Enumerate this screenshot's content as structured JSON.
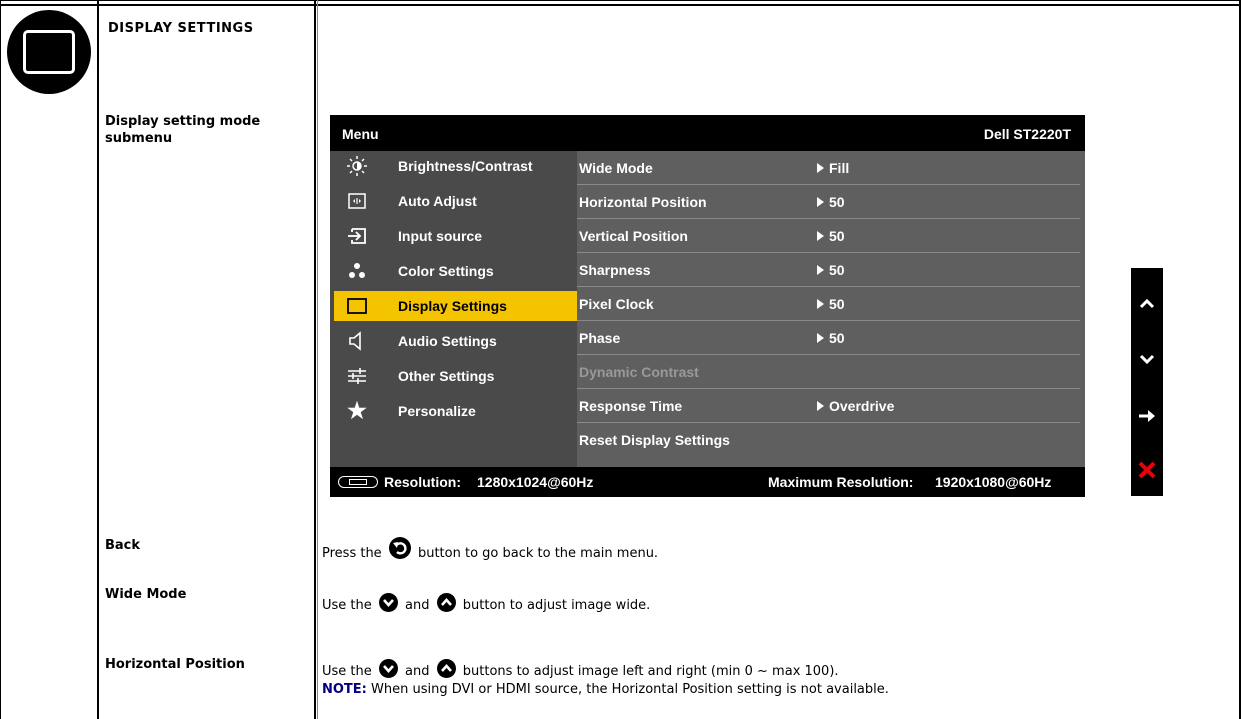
{
  "section": {
    "heading": "DISPLAY SETTINGS",
    "icon": "display-settings-icon"
  },
  "rows": {
    "submenu_label": "Display setting mode submenu",
    "back_label": "Back",
    "wide_mode_label": "Wide Mode",
    "horizontal_position_label": "Horizontal Position"
  },
  "osd": {
    "menu_title": "Menu",
    "model": "Dell ST2220T",
    "nav": [
      {
        "label": "Brightness/Contrast",
        "icon": "brightness-icon"
      },
      {
        "label": "Auto Adjust",
        "icon": "auto-adjust-icon"
      },
      {
        "label": "Input source",
        "icon": "input-source-icon"
      },
      {
        "label": "Color Settings",
        "icon": "color-settings-icon"
      },
      {
        "label": "Display Settings",
        "icon": "display-icon",
        "active": true
      },
      {
        "label": "Audio Settings",
        "icon": "speaker-icon"
      },
      {
        "label": "Other Settings",
        "icon": "sliders-icon"
      },
      {
        "label": "Personalize",
        "icon": "star-icon"
      }
    ],
    "options": [
      {
        "name": "Wide Mode",
        "value": "Fill"
      },
      {
        "name": "Horizontal Position",
        "value": "50"
      },
      {
        "name": "Vertical Position",
        "value": "50"
      },
      {
        "name": "Sharpness",
        "value": "50"
      },
      {
        "name": "Pixel Clock",
        "value": "50"
      },
      {
        "name": "Phase",
        "value": "50"
      },
      {
        "name": "Dynamic Contrast",
        "value": "",
        "disabled": true
      },
      {
        "name": "Response Time",
        "value": "Overdrive"
      },
      {
        "name": "Reset Display Settings",
        "value": ""
      }
    ],
    "status": {
      "resolution_label": "Resolution:",
      "resolution_value": "1280x1024@60Hz",
      "max_label": "Maximum Resolution:",
      "max_value": "1920x1080@60Hz"
    },
    "controls": [
      "up-arrow-icon",
      "down-arrow-icon",
      "right-arrow-icon",
      "close-icon"
    ],
    "colors": {
      "highlight": "#f5c400",
      "exit": "#e8000b"
    }
  },
  "descriptions": {
    "back": {
      "pre": "Press the",
      "post": "button to go back to the main menu."
    },
    "wide_mode": {
      "pre": "Use the",
      "mid": "and",
      "post": "button to adjust image wide."
    },
    "horizontal_position": {
      "pre": "Use the",
      "mid": "and",
      "post": "buttons to adjust image left and right (min 0 ~ max 100).",
      "note_label": "NOTE:",
      "note_text": "When using DVI or HDMI source, the Horizontal Position setting is not available."
    }
  }
}
